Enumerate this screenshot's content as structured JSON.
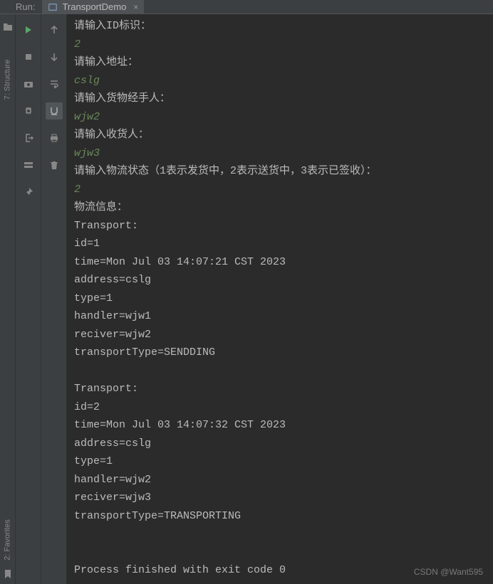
{
  "header": {
    "run_label": "Run:",
    "tab_name": "TransportDemo",
    "tab_close": "×"
  },
  "sidebar": {
    "structure_label": "7: Structure",
    "favorites_label": "2: Favorites"
  },
  "console": {
    "lines": [
      {
        "kind": "prompt",
        "text": "请输入ID标识："
      },
      {
        "kind": "input",
        "text": "2"
      },
      {
        "kind": "prompt",
        "text": "请输入地址："
      },
      {
        "kind": "input",
        "text": "cslg"
      },
      {
        "kind": "prompt",
        "text": "请输入货物经手人："
      },
      {
        "kind": "input",
        "text": "wjw2"
      },
      {
        "kind": "prompt",
        "text": "请输入收货人："
      },
      {
        "kind": "input",
        "text": "wjw3"
      },
      {
        "kind": "prompt",
        "text": "请输入物流状态（1表示发货中，2表示送货中，3表示已签收）："
      },
      {
        "kind": "input",
        "text": "2"
      },
      {
        "kind": "output",
        "text": "物流信息："
      },
      {
        "kind": "output",
        "text": "Transport:"
      },
      {
        "kind": "output",
        "text": "id=1"
      },
      {
        "kind": "output",
        "text": "time=Mon Jul 03 14:07:21 CST 2023"
      },
      {
        "kind": "output",
        "text": "address=cslg"
      },
      {
        "kind": "output",
        "text": "type=1"
      },
      {
        "kind": "output",
        "text": "handler=wjw1"
      },
      {
        "kind": "output",
        "text": "reciver=wjw2"
      },
      {
        "kind": "output",
        "text": "transportType=SENDDING"
      },
      {
        "kind": "output",
        "text": ""
      },
      {
        "kind": "output",
        "text": "Transport:"
      },
      {
        "kind": "output",
        "text": "id=2"
      },
      {
        "kind": "output",
        "text": "time=Mon Jul 03 14:07:32 CST 2023"
      },
      {
        "kind": "output",
        "text": "address=cslg"
      },
      {
        "kind": "output",
        "text": "type=1"
      },
      {
        "kind": "output",
        "text": "handler=wjw2"
      },
      {
        "kind": "output",
        "text": "reciver=wjw3"
      },
      {
        "kind": "output",
        "text": "transportType=TRANSPORTING"
      },
      {
        "kind": "output",
        "text": ""
      },
      {
        "kind": "output",
        "text": ""
      },
      {
        "kind": "output",
        "text": "Process finished with exit code 0"
      }
    ]
  },
  "watermark": "CSDN @Want595"
}
